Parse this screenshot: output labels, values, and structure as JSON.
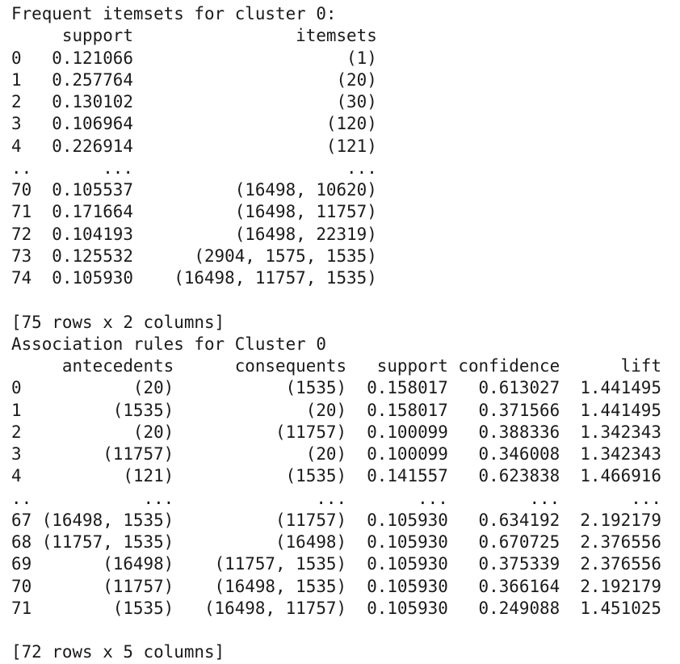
{
  "frequent_itemsets": {
    "title": "Frequent itemsets for cluster 0:",
    "columns": [
      "support",
      "itemsets"
    ],
    "rows": [
      {
        "index": "0",
        "support": "0.121066",
        "itemsets": "(1)"
      },
      {
        "index": "1",
        "support": "0.257764",
        "itemsets": "(20)"
      },
      {
        "index": "2",
        "support": "0.130102",
        "itemsets": "(30)"
      },
      {
        "index": "3",
        "support": "0.106964",
        "itemsets": "(120)"
      },
      {
        "index": "4",
        "support": "0.226914",
        "itemsets": "(121)"
      },
      {
        "index": "..",
        "support": "...",
        "itemsets": "..."
      },
      {
        "index": "70",
        "support": "0.105537",
        "itemsets": "(16498, 10620)"
      },
      {
        "index": "71",
        "support": "0.171664",
        "itemsets": "(16498, 11757)"
      },
      {
        "index": "72",
        "support": "0.104193",
        "itemsets": "(16498, 22319)"
      },
      {
        "index": "73",
        "support": "0.125532",
        "itemsets": "(2904, 1575, 1535)"
      },
      {
        "index": "74",
        "support": "0.105930",
        "itemsets": "(16498, 11757, 1535)"
      }
    ],
    "shape": "[75 rows x 2 columns]"
  },
  "association_rules": {
    "title": "Association rules for Cluster 0",
    "columns": [
      "antecedents",
      "consequents",
      "support",
      "confidence",
      "lift"
    ],
    "rows": [
      {
        "index": "0",
        "antecedents": "(20)",
        "consequents": "(1535)",
        "support": "0.158017",
        "confidence": "0.613027",
        "lift": "1.441495"
      },
      {
        "index": "1",
        "antecedents": "(1535)",
        "consequents": "(20)",
        "support": "0.158017",
        "confidence": "0.371566",
        "lift": "1.441495"
      },
      {
        "index": "2",
        "antecedents": "(20)",
        "consequents": "(11757)",
        "support": "0.100099",
        "confidence": "0.388336",
        "lift": "1.342343"
      },
      {
        "index": "3",
        "antecedents": "(11757)",
        "consequents": "(20)",
        "support": "0.100099",
        "confidence": "0.346008",
        "lift": "1.342343"
      },
      {
        "index": "4",
        "antecedents": "(121)",
        "consequents": "(1535)",
        "support": "0.141557",
        "confidence": "0.623838",
        "lift": "1.466916"
      },
      {
        "index": "..",
        "antecedents": "...",
        "consequents": "...",
        "support": "...",
        "confidence": "...",
        "lift": "..."
      },
      {
        "index": "67",
        "antecedents": "(16498, 1535)",
        "consequents": "(11757)",
        "support": "0.105930",
        "confidence": "0.634192",
        "lift": "2.192179"
      },
      {
        "index": "68",
        "antecedents": "(11757, 1535)",
        "consequents": "(16498)",
        "support": "0.105930",
        "confidence": "0.670725",
        "lift": "2.376556"
      },
      {
        "index": "69",
        "antecedents": "(16498)",
        "consequents": "(11757, 1535)",
        "support": "0.105930",
        "confidence": "0.375339",
        "lift": "2.376556"
      },
      {
        "index": "70",
        "antecedents": "(11757)",
        "consequents": "(16498, 1535)",
        "support": "0.105930",
        "confidence": "0.366164",
        "lift": "2.192179"
      },
      {
        "index": "71",
        "antecedents": "(1535)",
        "consequents": "(16498, 11757)",
        "support": "0.105930",
        "confidence": "0.249088",
        "lift": "1.451025"
      }
    ],
    "shape": "[72 rows x 5 columns]"
  }
}
